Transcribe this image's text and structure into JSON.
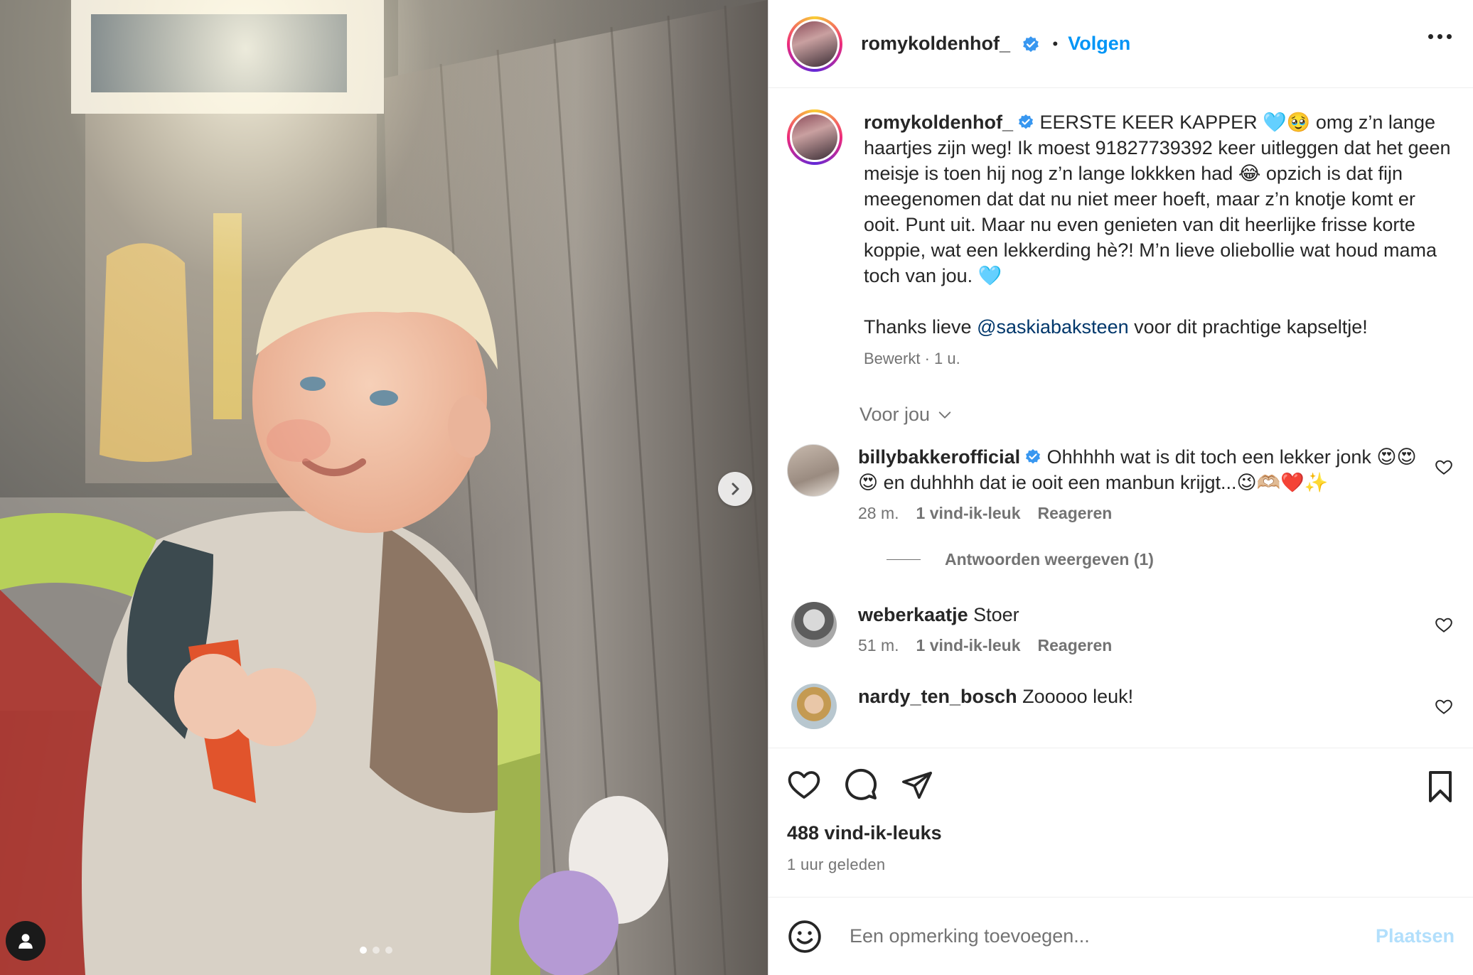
{
  "post": {
    "author": "romykoldenhof_",
    "follow_label": "Volgen",
    "separator": "•",
    "media": {
      "slide_count": 3,
      "active_slide": 1
    }
  },
  "caption": {
    "username": "romykoldenhof_",
    "text": " EERSTE KEER KAPPER 🩵🥹 omg z’n lange haartjes zijn weg! Ik moest 91827739392 keer uitleggen dat het geen meisje is toen hij nog z’n lange lokkken had 😂 opzich is dat fijn meegenomen dat dat nu niet meer hoeft, maar z’n knotje komt er ooit. Punt uit. Maar nu even genieten van dit heerlijke frisse korte koppie, wat een lekkerding hè?! M’n lieve oliebollie wat houd mama toch van jou. 🩵",
    "thanks_prefix": "Thanks lieve ",
    "mention": "@saskiabaksteen",
    "thanks_suffix": " voor dit prachtige kapseltje!",
    "meta": "Bewerkt · 1 u."
  },
  "for_you_label": "Voor jou",
  "comments": [
    {
      "username": "billybakkerofficial",
      "verified": true,
      "text": " Ohhhhh wat is dit toch een lekker jonk 😍😍😍 en duhhhh dat ie ooit een manbun krijgt...😉🫶🏼❤️✨",
      "time": "28 m.",
      "likes": "1 vind-ik-leuk",
      "reply": "Reageren",
      "view_replies": "Antwoorden weergeven (1)"
    },
    {
      "username": "weberkaatje",
      "verified": false,
      "text": " Stoer",
      "time": "51 m.",
      "likes": "1 vind-ik-leuk",
      "reply": "Reageren"
    },
    {
      "username": "nardy_ten_bosch",
      "verified": false,
      "text": " Zooooo leuk!"
    }
  ],
  "stats": {
    "likes": "488 vind-ik-leuks",
    "time": "1 uur geleden"
  },
  "add_comment": {
    "placeholder": "Een opmerking toevoegen...",
    "post_label": "Plaatsen"
  },
  "colors": {
    "accent": "#0095f6",
    "verified": "#3897f0",
    "muted": "#737373",
    "post_disabled": "#b2dffc"
  }
}
